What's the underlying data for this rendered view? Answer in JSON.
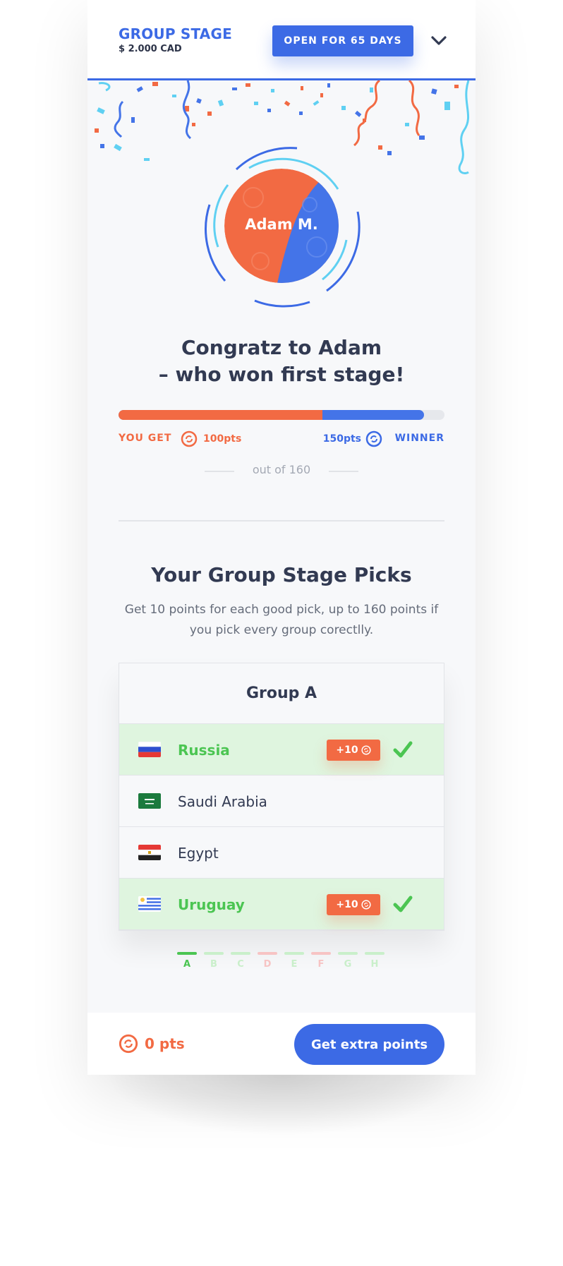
{
  "colors": {
    "brand_blue": "#3c6ae5",
    "accent_orange": "#f26a43",
    "success_green": "#4bc552",
    "text_dark": "#323a52"
  },
  "header": {
    "title": "GROUP STAGE",
    "prize": "$ 2.000 CAD",
    "status_button": "OPEN FOR 65 DAYS",
    "menu_icon": "chevron-down-icon"
  },
  "winner": {
    "avatar_name": "Adam M.",
    "congrats_line1": "Congratz to Adam",
    "congrats_line2": "– who won first stage!"
  },
  "progress": {
    "you_label": "YOU GET",
    "you_points": "100pts",
    "you_value": 100,
    "winner_points": "150pts",
    "winner_value": 150,
    "winner_label": "WINNER",
    "max_value": 160,
    "out_of": "out of 160",
    "coin_icon": "coin-icon"
  },
  "picks": {
    "title": "Your Group Stage Picks",
    "description": "Get 10 points for each good pick, up to 160 points if you pick every group corectlly."
  },
  "group": {
    "title": "Group A",
    "teams": [
      {
        "name": "Russia",
        "flag": "russia-flag-icon",
        "correct": true,
        "badge": "+10"
      },
      {
        "name": "Saudi Arabia",
        "flag": "saudi-arabia-flag-icon",
        "correct": false,
        "badge": ""
      },
      {
        "name": "Egypt",
        "flag": "egypt-flag-icon",
        "correct": false,
        "badge": ""
      },
      {
        "name": "Uruguay",
        "flag": "uruguay-flag-icon",
        "correct": true,
        "badge": "+10"
      }
    ]
  },
  "pagination": {
    "active": "A",
    "groups": [
      {
        "letter": "A",
        "state": "active"
      },
      {
        "letter": "B",
        "state": "good"
      },
      {
        "letter": "C",
        "state": "good"
      },
      {
        "letter": "D",
        "state": "bad"
      },
      {
        "letter": "E",
        "state": "good"
      },
      {
        "letter": "F",
        "state": "bad"
      },
      {
        "letter": "G",
        "state": "good"
      },
      {
        "letter": "H",
        "state": "good"
      }
    ]
  },
  "footer": {
    "points": "0 pts",
    "button": "Get extra points"
  }
}
